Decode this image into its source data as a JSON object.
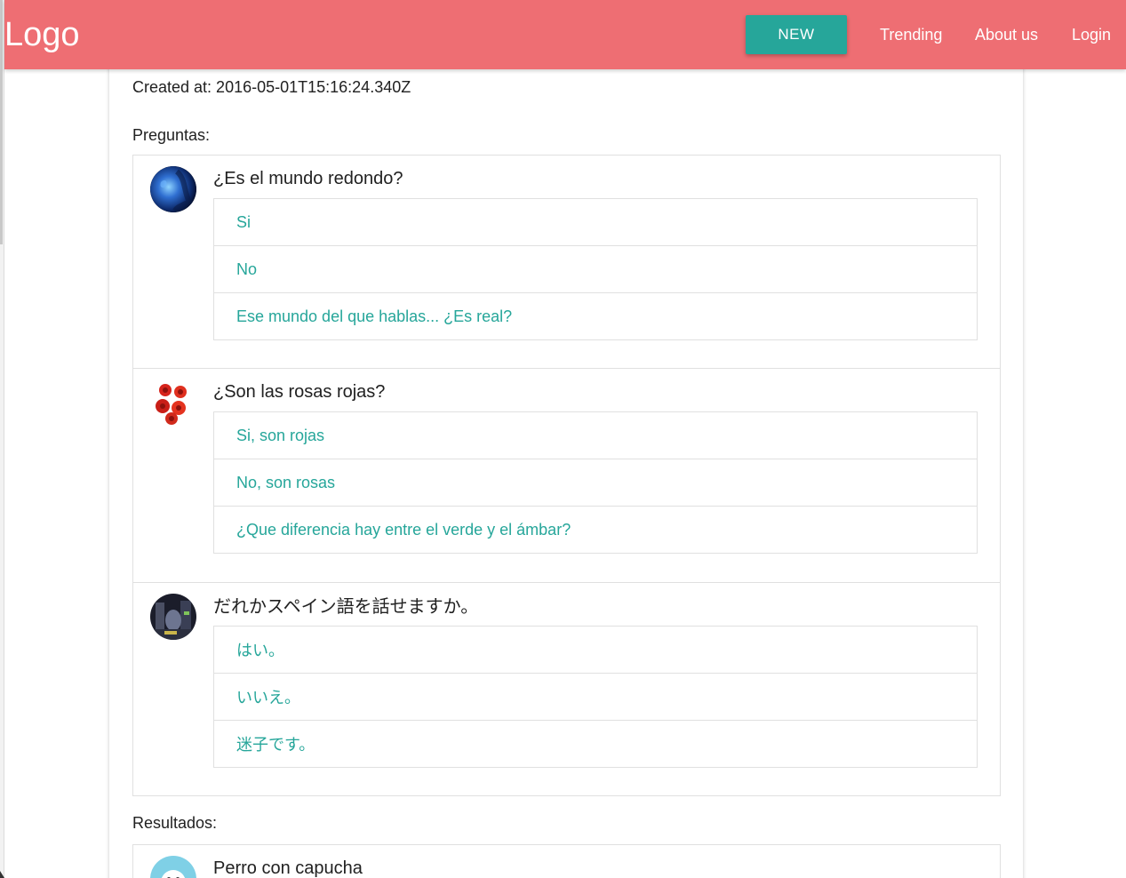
{
  "navbar": {
    "logo": "Logo",
    "new_button": "NEW",
    "links": [
      "Trending",
      "About us",
      "Login"
    ]
  },
  "meta": {
    "created_at": "Created at: 2016-05-01T15:16:24.340Z",
    "questions_heading": "Preguntas:",
    "results_heading": "Resultados:"
  },
  "questions": [
    {
      "avatar": "earth-planet-avatar",
      "title": "¿Es el mundo redondo?",
      "answers": [
        "Si",
        "No",
        "Ese mundo del que hablas... ¿Es real?"
      ]
    },
    {
      "avatar": "red-roses-avatar",
      "title": "¿Son las rosas rojas?",
      "answers": [
        "Si, son rojas",
        "No, son rosas",
        "¿Que diferencia hay entre el verde y el ámbar?"
      ]
    },
    {
      "avatar": "dark-scene-avatar",
      "title": "だれかスペイン語を話せますか。",
      "answers": [
        "はい。",
        "いいえ。",
        "迷子です。"
      ]
    }
  ],
  "results": [
    {
      "avatar": "hooded-dog-avatar",
      "title": "Perro con capucha"
    }
  ],
  "colors": {
    "navbar": "#ee6e73",
    "accent": "#26a69a",
    "text": "#212121",
    "border": "#e0e0e0"
  }
}
